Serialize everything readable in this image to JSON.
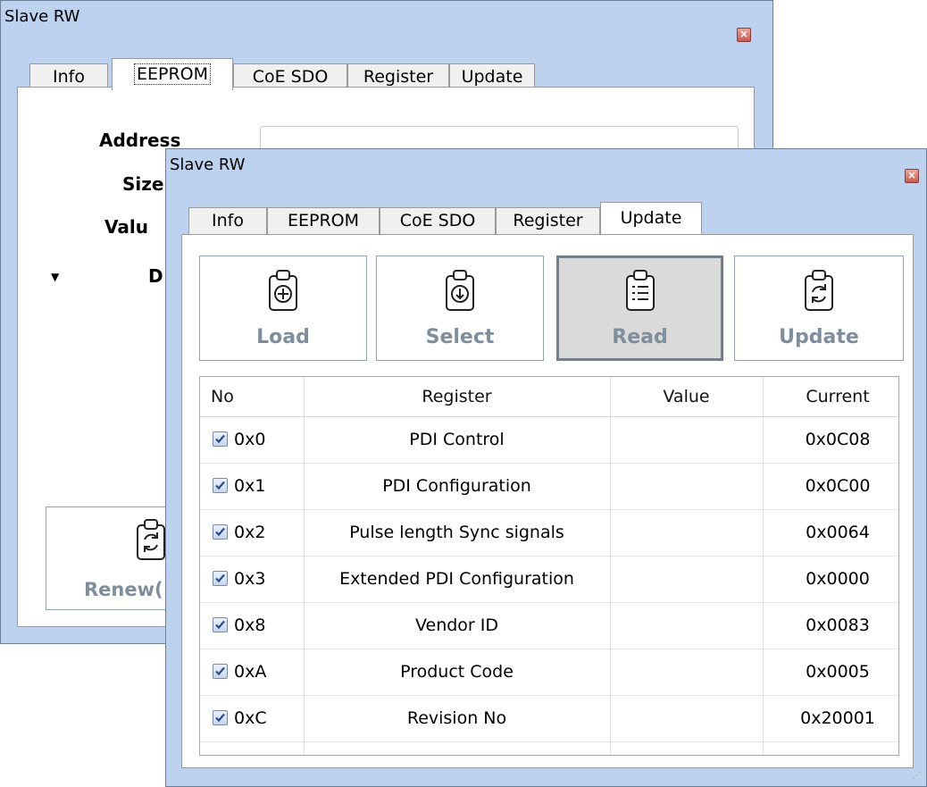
{
  "back_window": {
    "title": "Slave RW",
    "tabs": [
      "Info",
      "EEPROM",
      "CoE SDO",
      "Register",
      "Update"
    ],
    "labels": {
      "address": "Address",
      "size": "Size",
      "value": "Valu",
      "d": "D"
    },
    "renew_button": "Renew("
  },
  "front_window": {
    "title": "Slave RW",
    "tabs": [
      "Info",
      "EEPROM",
      "CoE SDO",
      "Register",
      "Update"
    ],
    "toolbar": [
      {
        "label": "Load",
        "icon": "clipboard-add-icon"
      },
      {
        "label": "Select",
        "icon": "clipboard-download-icon"
      },
      {
        "label": "Read",
        "icon": "clipboard-list-icon"
      },
      {
        "label": "Update",
        "icon": "clipboard-refresh-icon"
      }
    ],
    "grid": {
      "columns": [
        "No",
        "Register",
        "Value",
        "Current"
      ],
      "rows": [
        {
          "no": "0x0",
          "register": "PDI Control",
          "value": "",
          "current": "0x0C08",
          "checked": true
        },
        {
          "no": "0x1",
          "register": "PDI Configuration",
          "value": "",
          "current": "0x0C00",
          "checked": true
        },
        {
          "no": "0x2",
          "register": "Pulse length Sync signals",
          "value": "",
          "current": "0x0064",
          "checked": true
        },
        {
          "no": "0x3",
          "register": "Extended PDI Configuration",
          "value": "",
          "current": "0x0000",
          "checked": true
        },
        {
          "no": "0x8",
          "register": "Vendor ID",
          "value": "",
          "current": "0x0083",
          "checked": true
        },
        {
          "no": "0xA",
          "register": "Product Code",
          "value": "",
          "current": "0x0005",
          "checked": true
        },
        {
          "no": "0xC",
          "register": "Revision No",
          "value": "",
          "current": "0x20001",
          "checked": true
        }
      ]
    }
  }
}
